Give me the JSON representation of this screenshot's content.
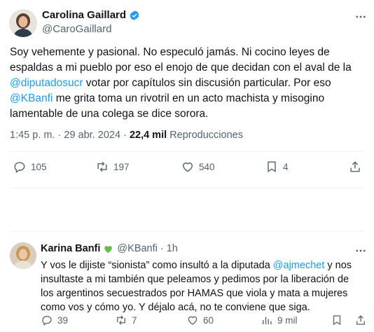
{
  "tweet": {
    "author_name": "Carolina Gaillard",
    "author_handle": "@CaroGaillard",
    "text_1": "Soy vehemente y pasional. No especuló jamás. Ni cocino leyes de espaldas a mi pueblo por eso el enojo de que decidan con el aval de la ",
    "mention_1": "@diputadosucr",
    "text_2": " votar por capítulos sin discusión particular. Por eso ",
    "mention_2": "@KBanfi",
    "text_3": " me grita toma un rivotril en un acto machista y misogino lamentable de una colega se dice sorora.",
    "time": "1:45 p. m.",
    "sep": "·",
    "date": "29 abr. 2024",
    "views_count": "22,4 mil",
    "views_label": "Reproducciones",
    "replies": "105",
    "retweets": "197",
    "likes": "540",
    "bookmarks": "4"
  },
  "reply": {
    "author_name": "Karina Banfi",
    "author_handle": "@KBanfi",
    "sep": "·",
    "time_ago": "1h",
    "text_1": "Y vos le dijiste “sionista” como insultó a la diputada ",
    "mention_1": "@ajmechet",
    "text_2": " y nos insultaste a mi también que peleamos y pedimos por la liberación de los argentinos secuestrados por HAMAS que viola y mata a mujeres como vos y cómo yo. Y déjalo acá, no te conviene que siga.",
    "replies": "39",
    "retweets": "7",
    "likes": "60",
    "views": "9 mil"
  },
  "colors": {
    "verified_blue": "#1d9bf0",
    "green_heart": "#66bb45",
    "muted": "#536471",
    "link": "#1d9bf0"
  },
  "icons": [
    "verified-badge-icon",
    "more-options-icon",
    "reply-icon",
    "retweet-icon",
    "like-icon",
    "bookmark-icon",
    "share-icon",
    "views-icon",
    "green-heart-icon"
  ]
}
